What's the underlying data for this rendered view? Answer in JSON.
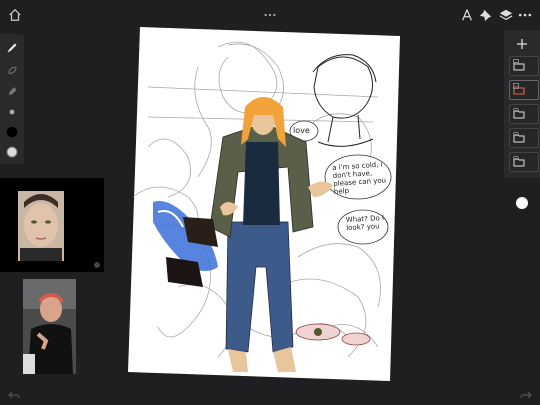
{
  "app": {
    "topbar": {
      "home_icon": "home-icon",
      "handle_icon": "more-horizontal-icon",
      "right_icons": [
        "compass-icon",
        "pin-icon",
        "layers-icon",
        "more-icon"
      ]
    },
    "tools": [
      "brush-icon",
      "smudge-icon",
      "eraser-icon",
      "brush-size-small",
      "brush-size-large",
      "color-swatch"
    ],
    "layers": {
      "add_icon": "plus-icon",
      "items": [
        {
          "icon": "folder-icon",
          "active": false
        },
        {
          "icon": "folder-icon",
          "active": true,
          "accent": "#e06a3b"
        },
        {
          "icon": "folder-icon",
          "active": false
        },
        {
          "icon": "folder-icon",
          "active": false
        },
        {
          "icon": "folder-icon",
          "active": false
        }
      ],
      "color_dot": "#ffffff"
    },
    "references": [
      {
        "name": "reference-portrait-1"
      },
      {
        "name": "reference-portrait-2"
      }
    ],
    "canvas": {
      "speech_1": "a i'm so cold, i don't have, please can you help",
      "speech_2": "What? Do I look? you",
      "speech_3": "love",
      "colors": {
        "hair": "#f2a23a",
        "jacket": "#5a5f4a",
        "shirt": "#1a2a3f",
        "jeans": "#3c5a8a",
        "skin": "#e8c59a",
        "blue_accent": "#3a6ed8"
      }
    },
    "bottom": {
      "undo_icon": "undo-icon",
      "redo_icon": "redo-icon"
    }
  }
}
